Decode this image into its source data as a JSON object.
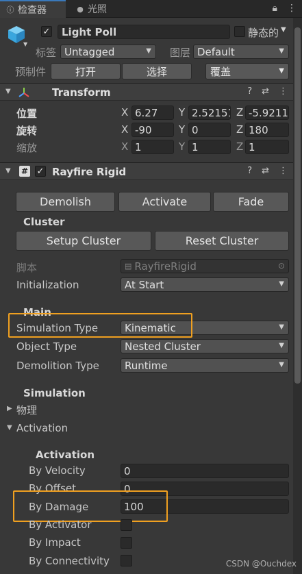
{
  "tabs": {
    "inspector": "检查器",
    "lighting": "光照"
  },
  "header": {
    "object_name": "Light Poll",
    "static_label": "静态的",
    "tag_label": "标签",
    "tag_value": "Untagged",
    "layer_label": "图层",
    "layer_value": "Default",
    "prefab_label": "预制件",
    "open_button": "打开",
    "select_button": "选择",
    "override_button": "覆盖"
  },
  "transform": {
    "title": "Transform",
    "rows": [
      {
        "label": "位置",
        "x": "6.27",
        "y": "2.52151",
        "z": "-5.9211"
      },
      {
        "label": "旋转",
        "x": "-90",
        "y": "0",
        "z": "180"
      },
      {
        "label": "缩放",
        "x": "1",
        "y": "1",
        "z": "1"
      }
    ],
    "axis_x": "X",
    "axis_y": "Y",
    "axis_z": "Z"
  },
  "rayfire": {
    "title": "Rayfire Rigid",
    "demolish": "Demolish",
    "activate": "Activate",
    "fade": "Fade",
    "cluster_heading": "Cluster",
    "setup_cluster": "Setup Cluster",
    "reset_cluster": "Reset Cluster",
    "script_label": "脚本",
    "script_value": "RayfireRigid",
    "initialization_label": "Initialization",
    "initialization_value": "At Start",
    "main_heading": "Main",
    "simulation_type_label": "Simulation Type",
    "simulation_type_value": "Kinematic",
    "object_type_label": "Object Type",
    "object_type_value": "Nested Cluster",
    "demolition_type_label": "Demolition Type",
    "demolition_type_value": "Runtime",
    "simulation_heading": "Simulation",
    "physics_label": "物理",
    "activation_foldout": "Activation",
    "activation_heading": "Activation",
    "by_velocity_label": "By Velocity",
    "by_velocity_value": "0",
    "by_offset_label": "By Offset",
    "by_offset_value": "0",
    "by_damage_label": "By Damage",
    "by_damage_value": "100",
    "by_activator_label": "By Activator",
    "by_impact_label": "By Impact",
    "by_connectivity_label": "By Connectivity"
  },
  "watermark": "CSDN @Ouchdex",
  "colors": {
    "highlight": "#f0a020",
    "accent_tab": "#3a79bb",
    "cube": "#4fb3ea"
  }
}
